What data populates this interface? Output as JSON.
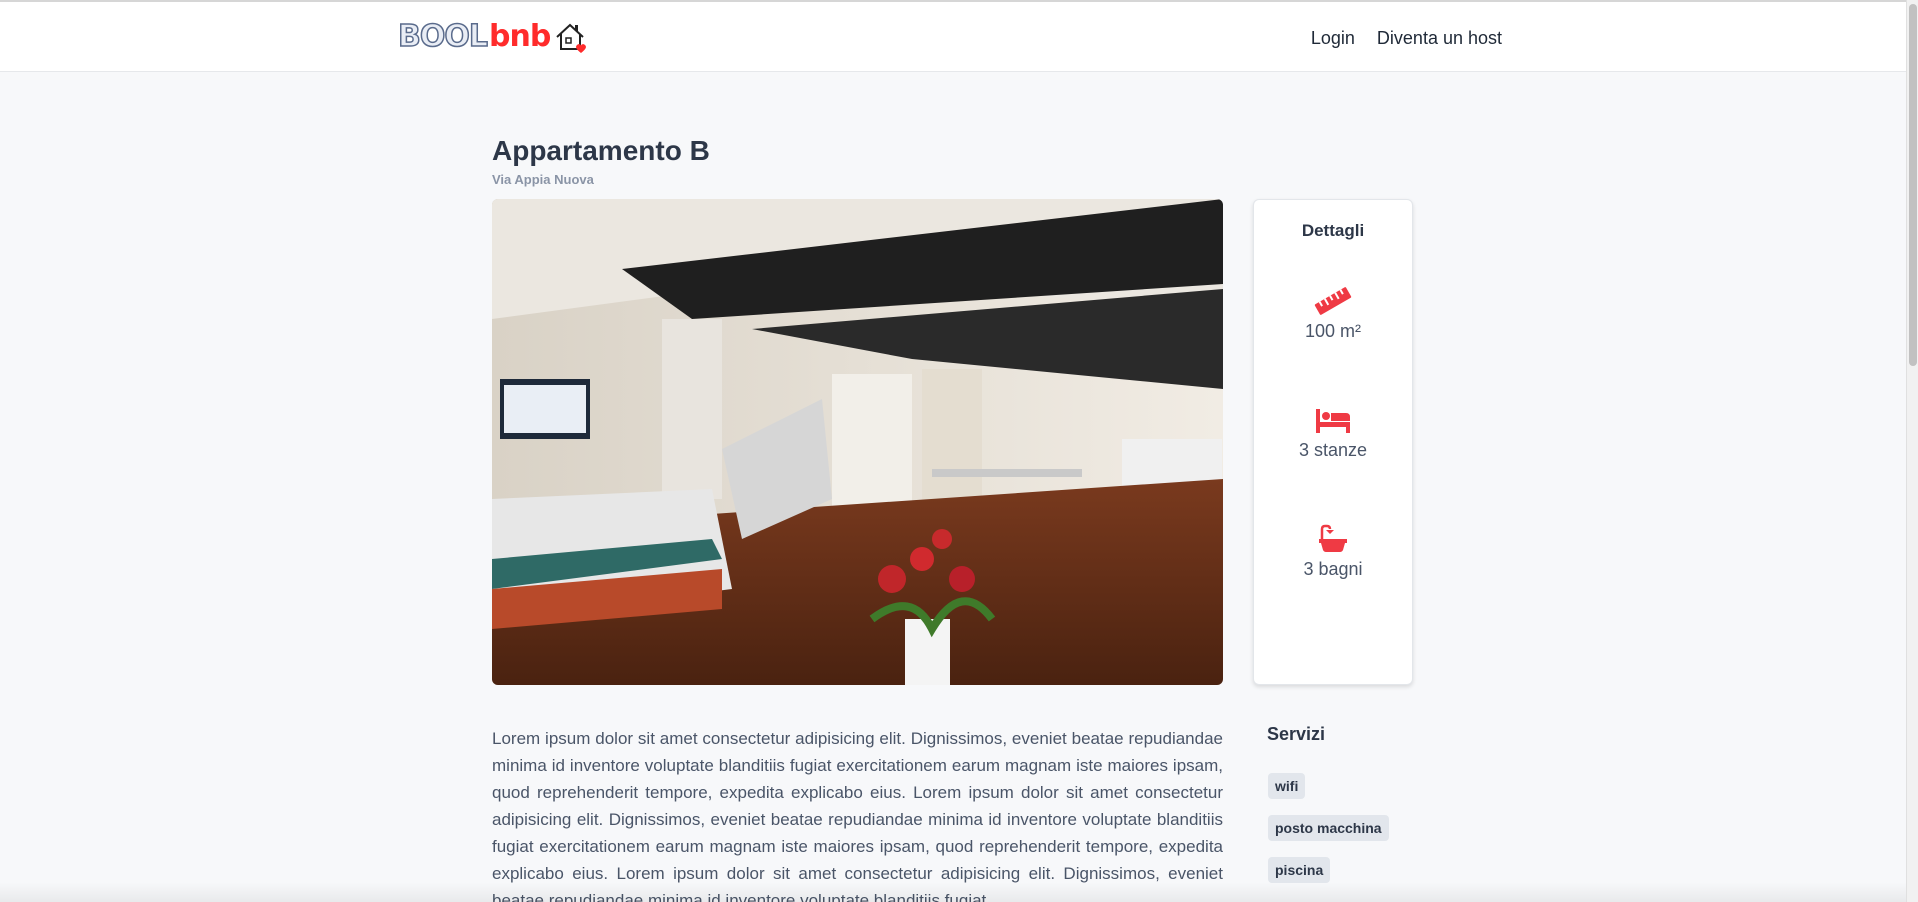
{
  "brand": {
    "logo_text_part1": "BOOL",
    "logo_text_part2": "bnb",
    "logo_icon": "house-heart-icon",
    "accent_color": "#ff2b2b"
  },
  "nav": {
    "login": "Login",
    "become_host": "Diventa un host"
  },
  "listing": {
    "title": "Appartamento B",
    "address": "Via Appia Nuova",
    "photo_alt": "Appartamento B"
  },
  "details": {
    "heading": "Dettagli",
    "items": [
      {
        "icon": "ruler-icon",
        "value": "100 m²"
      },
      {
        "icon": "bed-icon",
        "value": "3 stanze"
      },
      {
        "icon": "bathtub-icon",
        "value": "3 bagni"
      }
    ]
  },
  "description": "Lorem ipsum dolor sit amet consectetur adipisicing elit. Dignissimos, eveniet beatae repudiandae minima id inventore voluptate blanditiis fugiat exercitationem earum magnam iste maiores ipsam, quod reprehenderit tempore, expedita explicabo eius. Lorem ipsum dolor sit amet consectetur adipisicing elit. Dignissimos, eveniet beatae repudiandae minima id inventore voluptate blanditiis fugiat exercitationem earum magnam iste maiores ipsam, quod reprehenderit tempore, expedita explicabo eius. Lorem ipsum dolor sit amet consectetur adipisicing elit. Dignissimos, eveniet beatae repudiandae minima id inventore voluptate blanditiis fugiat",
  "services": {
    "heading": "Servizi",
    "items": [
      "wifi",
      "posto macchina",
      "piscina"
    ]
  }
}
